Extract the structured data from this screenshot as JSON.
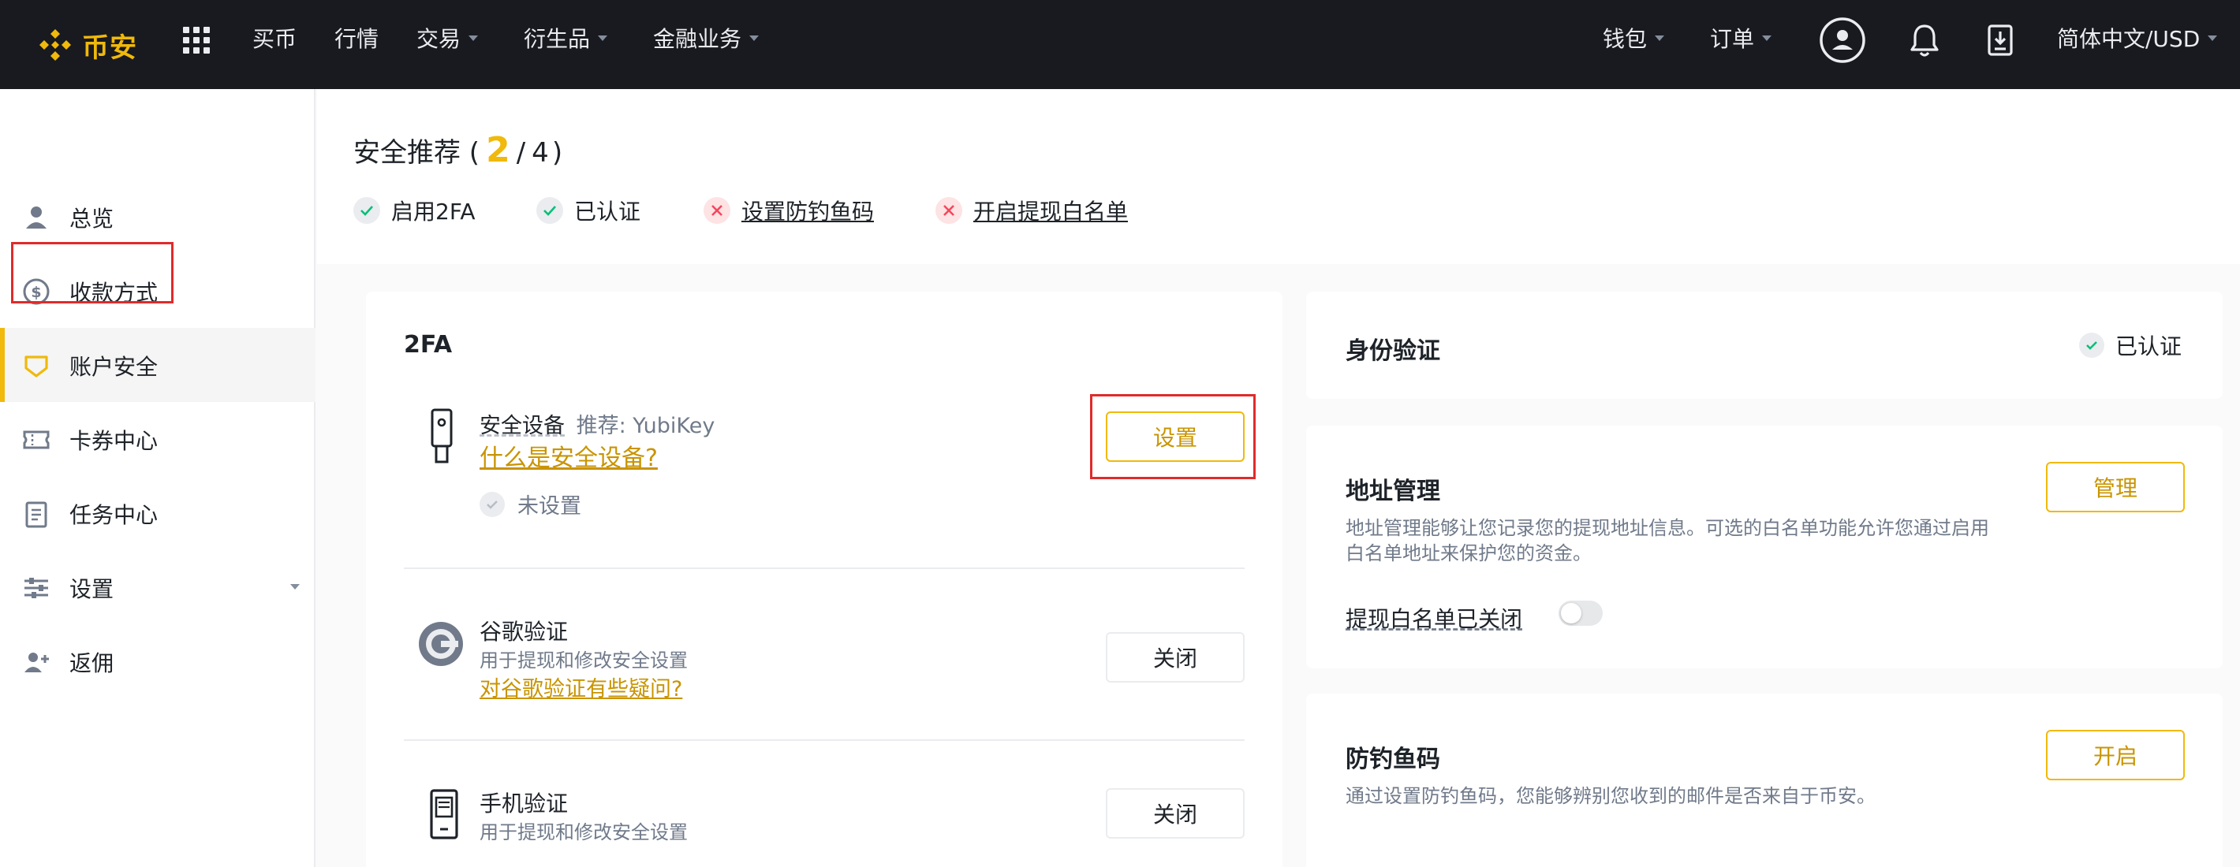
{
  "brand": {
    "name": "币安",
    "accent": "#F0B90B",
    "nav_bg": "#181A20"
  },
  "topnav": {
    "items": [
      {
        "label": "买币",
        "dropdown": false
      },
      {
        "label": "行情",
        "dropdown": false
      },
      {
        "label": "交易",
        "dropdown": true
      },
      {
        "label": "衍生品",
        "dropdown": true
      },
      {
        "label": "金融业务",
        "dropdown": true
      }
    ],
    "right": {
      "wallet": "钱包",
      "orders": "订单",
      "language": "简体中文/USD",
      "icons": [
        "user-avatar-icon",
        "bell-icon",
        "download-icon"
      ]
    }
  },
  "sidebar": {
    "items": [
      {
        "label": "总览",
        "icon": "user-icon"
      },
      {
        "label": "收款方式",
        "icon": "dollar-icon"
      },
      {
        "label": "账户安全",
        "icon": "shield-icon",
        "active": true
      },
      {
        "label": "卡券中心",
        "icon": "ticket-icon"
      },
      {
        "label": "任务中心",
        "icon": "checklist-icon"
      },
      {
        "label": "设置",
        "icon": "sliders-icon",
        "dropdown": true
      },
      {
        "label": "返佣",
        "icon": "user-plus-icon"
      }
    ]
  },
  "security": {
    "title_prefix": "安全推荐 (",
    "completed": "2",
    "separator": "/",
    "total": "4",
    "title_suffix": ")",
    "checks": [
      {
        "label": "启用2FA",
        "status": "done"
      },
      {
        "label": "已认证",
        "status": "done"
      },
      {
        "label": "设置防钓鱼码",
        "status": "todo"
      },
      {
        "label": "开启提现白名单",
        "status": "todo"
      }
    ]
  },
  "twofa": {
    "title": "2FA",
    "security_device": {
      "name": "安全设备",
      "recommend": "推荐: YubiKey",
      "help_link": "什么是安全设备?",
      "status": "未设置",
      "button": "设置"
    },
    "google": {
      "name": "谷歌验证",
      "desc": "用于提现和修改安全设置",
      "help_link": "对谷歌验证有些疑问?",
      "button": "关闭"
    },
    "phone": {
      "name": "手机验证",
      "desc": "用于提现和修改安全设置",
      "button": "关闭"
    }
  },
  "identity": {
    "title": "身份验证",
    "status": "已认证"
  },
  "address": {
    "title": "地址管理",
    "desc_line1": "地址管理能够让您记录您的提现地址信息。可选的白名单功能允许您通过启用",
    "desc_line2": "白名单地址来保护您的资金。",
    "whitelist_label": "提现白名单已关闭",
    "whitelist_on": false,
    "button": "管理"
  },
  "antiphishing": {
    "title": "防钓鱼码",
    "desc": "通过设置防钓鱼码，您能够辨别您收到的邮件是否来自于币安。",
    "button": "开启"
  }
}
